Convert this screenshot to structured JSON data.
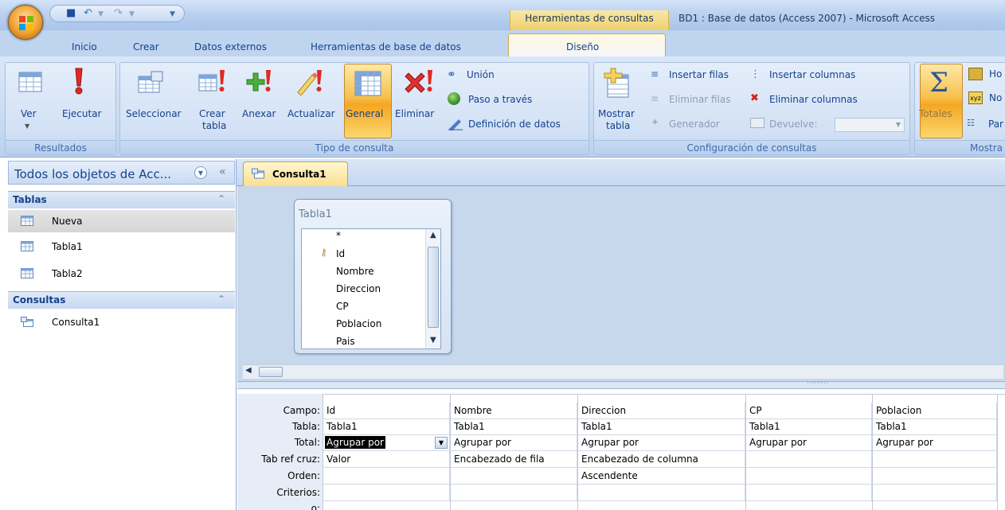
{
  "titlebar": {
    "context_title": "Herramientas de consultas",
    "window_title": "BD1 : Base de datos (Access 2007) - Microsoft Access"
  },
  "tabs": [
    "Inicio",
    "Crear",
    "Datos externos",
    "Herramientas de base de datos",
    "Diseño"
  ],
  "ribbon": {
    "resultados": {
      "label": "Resultados",
      "ver": "Ver",
      "ejecutar": "Ejecutar"
    },
    "tipo": {
      "label": "Tipo de consulta",
      "seleccionar": "Seleccionar",
      "crear": "Crear",
      "tabla": "tabla",
      "anexar": "Anexar",
      "actualizar": "Actualizar",
      "general": "General",
      "eliminar": "Eliminar",
      "union": "Unión",
      "paso": "Paso a través",
      "definicion": "Definición de datos"
    },
    "config": {
      "label": "Configuración de consultas",
      "mostrar": "Mostrar",
      "tabla": "tabla",
      "insertar_filas": "Insertar filas",
      "eliminar_filas": "Eliminar filas",
      "generador": "Generador",
      "insertar_columnas": "Insertar columnas",
      "eliminar_columnas": "Eliminar columnas",
      "devuelve": "Devuelve:"
    },
    "mostrar": {
      "label": "Mostra",
      "totales": "Totales",
      "ho": "Ho",
      "no": "No",
      "par": "Par"
    }
  },
  "nav": {
    "title": "Todos los objetos de Acc...",
    "sections": [
      {
        "label": "Tablas",
        "items": [
          "Nueva",
          "Tabla1",
          "Tabla2"
        ]
      },
      {
        "label": "Consultas",
        "items": [
          "Consulta1"
        ]
      }
    ]
  },
  "doc_tab": "Consulta1",
  "table_box": {
    "title": "Tabla1",
    "fields": [
      "*",
      "Id",
      "Nombre",
      "Direccion",
      "CP",
      "Poblacion",
      "Pais"
    ]
  },
  "grid": {
    "row_labels": [
      "Campo:",
      "Tabla:",
      "Total:",
      "Tab ref cruz:",
      "Orden:",
      "Criterios:",
      "o:"
    ],
    "columns": [
      {
        "campo": "Id",
        "tabla": "Tabla1",
        "total": "Agrupar por",
        "tabref": "Valor",
        "orden": ""
      },
      {
        "campo": "Nombre",
        "tabla": "Tabla1",
        "total": "Agrupar por",
        "tabref": "Encabezado de fila",
        "orden": ""
      },
      {
        "campo": "Direccion",
        "tabla": "Tabla1",
        "total": "Agrupar por",
        "tabref": "Encabezado de columna",
        "orden": "Ascendente"
      },
      {
        "campo": "CP",
        "tabla": "Tabla1",
        "total": "Agrupar por",
        "tabref": "",
        "orden": ""
      },
      {
        "campo": "Poblacion",
        "tabla": "Tabla1",
        "total": "Agrupar por",
        "tabref": "",
        "orden": ""
      }
    ]
  }
}
